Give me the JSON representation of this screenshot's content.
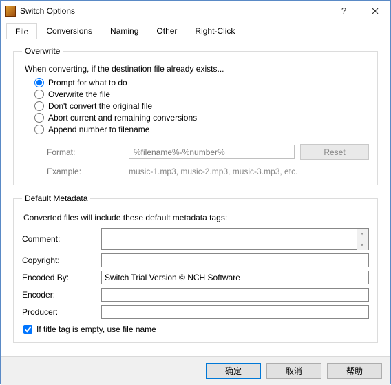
{
  "window": {
    "title": "Switch Options"
  },
  "tabs": {
    "file": "File",
    "conversions": "Conversions",
    "naming": "Naming",
    "other": "Other",
    "rightclick": "Right-Click"
  },
  "overwrite": {
    "legend": "Overwrite",
    "intro": "When converting, if the destination file already exists...",
    "options": {
      "prompt": "Prompt for what to do",
      "overwrite": "Overwrite the file",
      "dont": "Don't convert the original file",
      "abort": "Abort current and remaining conversions",
      "append": "Append number to filename"
    },
    "format_label": "Format:",
    "format_value": "%filename%-%number%",
    "reset_label": "Reset",
    "example_label": "Example:",
    "example_value": "music-1.mp3, music-2.mp3, music-3.mp3, etc."
  },
  "metadata": {
    "legend": "Default Metadata",
    "desc": "Converted files will include these default metadata tags:",
    "labels": {
      "comment": "Comment:",
      "copyright": "Copyright:",
      "encoded_by": "Encoded By:",
      "encoder": "Encoder:",
      "producer": "Producer:"
    },
    "values": {
      "comment": "",
      "copyright": "",
      "encoded_by": "Switch Trial Version © NCH Software",
      "encoder": "",
      "producer": ""
    },
    "title_checkbox": "If title tag is empty, use file name"
  },
  "footer": {
    "ok": "确定",
    "cancel": "取消",
    "help": "帮助"
  }
}
